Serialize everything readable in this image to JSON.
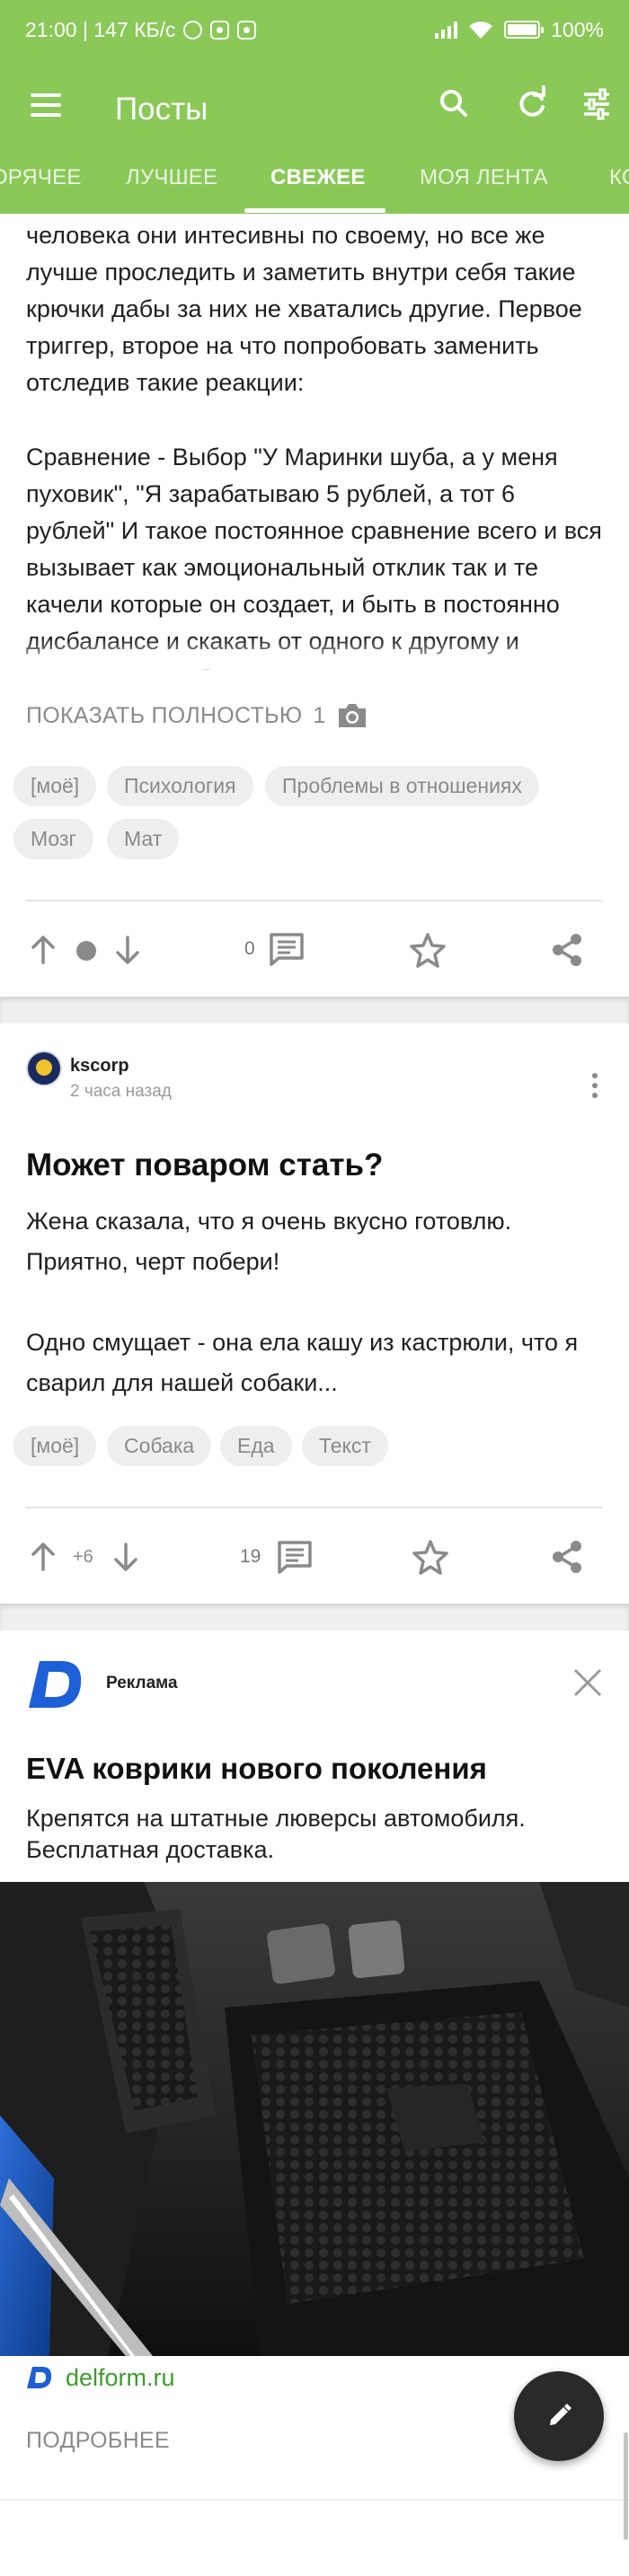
{
  "status_bar": {
    "time_info": "21:00 | 147 КБ/с",
    "battery": "100%",
    "battery_level": 1.0
  },
  "app_bar": {
    "title": "Посты",
    "icons": [
      "menu-icon",
      "search-icon",
      "refresh-icon",
      "filter-settings-icon"
    ]
  },
  "tabs": [
    {
      "label": "ГОРЯЧЕЕ",
      "active": false
    },
    {
      "label": "ЛУЧШЕЕ",
      "active": false
    },
    {
      "label": "СВЕЖЕЕ",
      "active": true
    },
    {
      "label": "МОЯ ЛЕНТА",
      "active": false
    },
    {
      "label": "КОММЕНТАРИИ",
      "active": false
    }
  ],
  "post1": {
    "text_part1": "человека они интесивны по своему, но все же лучше проследить и заметить внутри себя такие крючки дабы за них не хватались другие. Первое триггер, второе на что попробовать заменить отследив такие реакции:",
    "text_part2": "Сравнение - Выбор \"У Маринки шуба, а у меня пуховик\", \"Я зарабатываю 5 рублей, а тот 6 рублей\" И такое постоянное сравнение всего и вся вызывает как эмоциональный отклик так и те качели которые он создает, и быть в постоянно дисбалансе и скакать от одного к другому и утомительно и бесполезно.",
    "show_more": "ПОКАЗАТЬ ПОЛНОСТЬЮ",
    "image_count": "1",
    "tags": [
      "[моё]",
      "Психология",
      "Проблемы в отношениях",
      "Мозг",
      "Мат"
    ],
    "comments": "0"
  },
  "post2": {
    "author": "kscorp",
    "time": "2 часа назад",
    "title": "Может поваром стать?",
    "text": "Жена сказала, что я очень вкусно готовлю. Приятно, черт побери!\n\nОдно смущает - она ела кашу из кастрюли, что я сварил для нашей собаки...",
    "tags": [
      "[моё]",
      "Собака",
      "Еда",
      "Текст"
    ],
    "rating": "+6",
    "comments": "19"
  },
  "ad": {
    "label": "Реклама",
    "title": "EVA коврики нового поколения",
    "description": "Крепятся на штатные люверсы автомобиля. Бесплатная доставка.",
    "domain": "delform.ru",
    "more": "ПОДРОБНЕЕ"
  },
  "colors": {
    "header_green": "#8ac858",
    "link_green": "#3f9b2f",
    "ad_logo_blue": "#1d5fd6",
    "fab_dark": "#2a2a2a"
  }
}
